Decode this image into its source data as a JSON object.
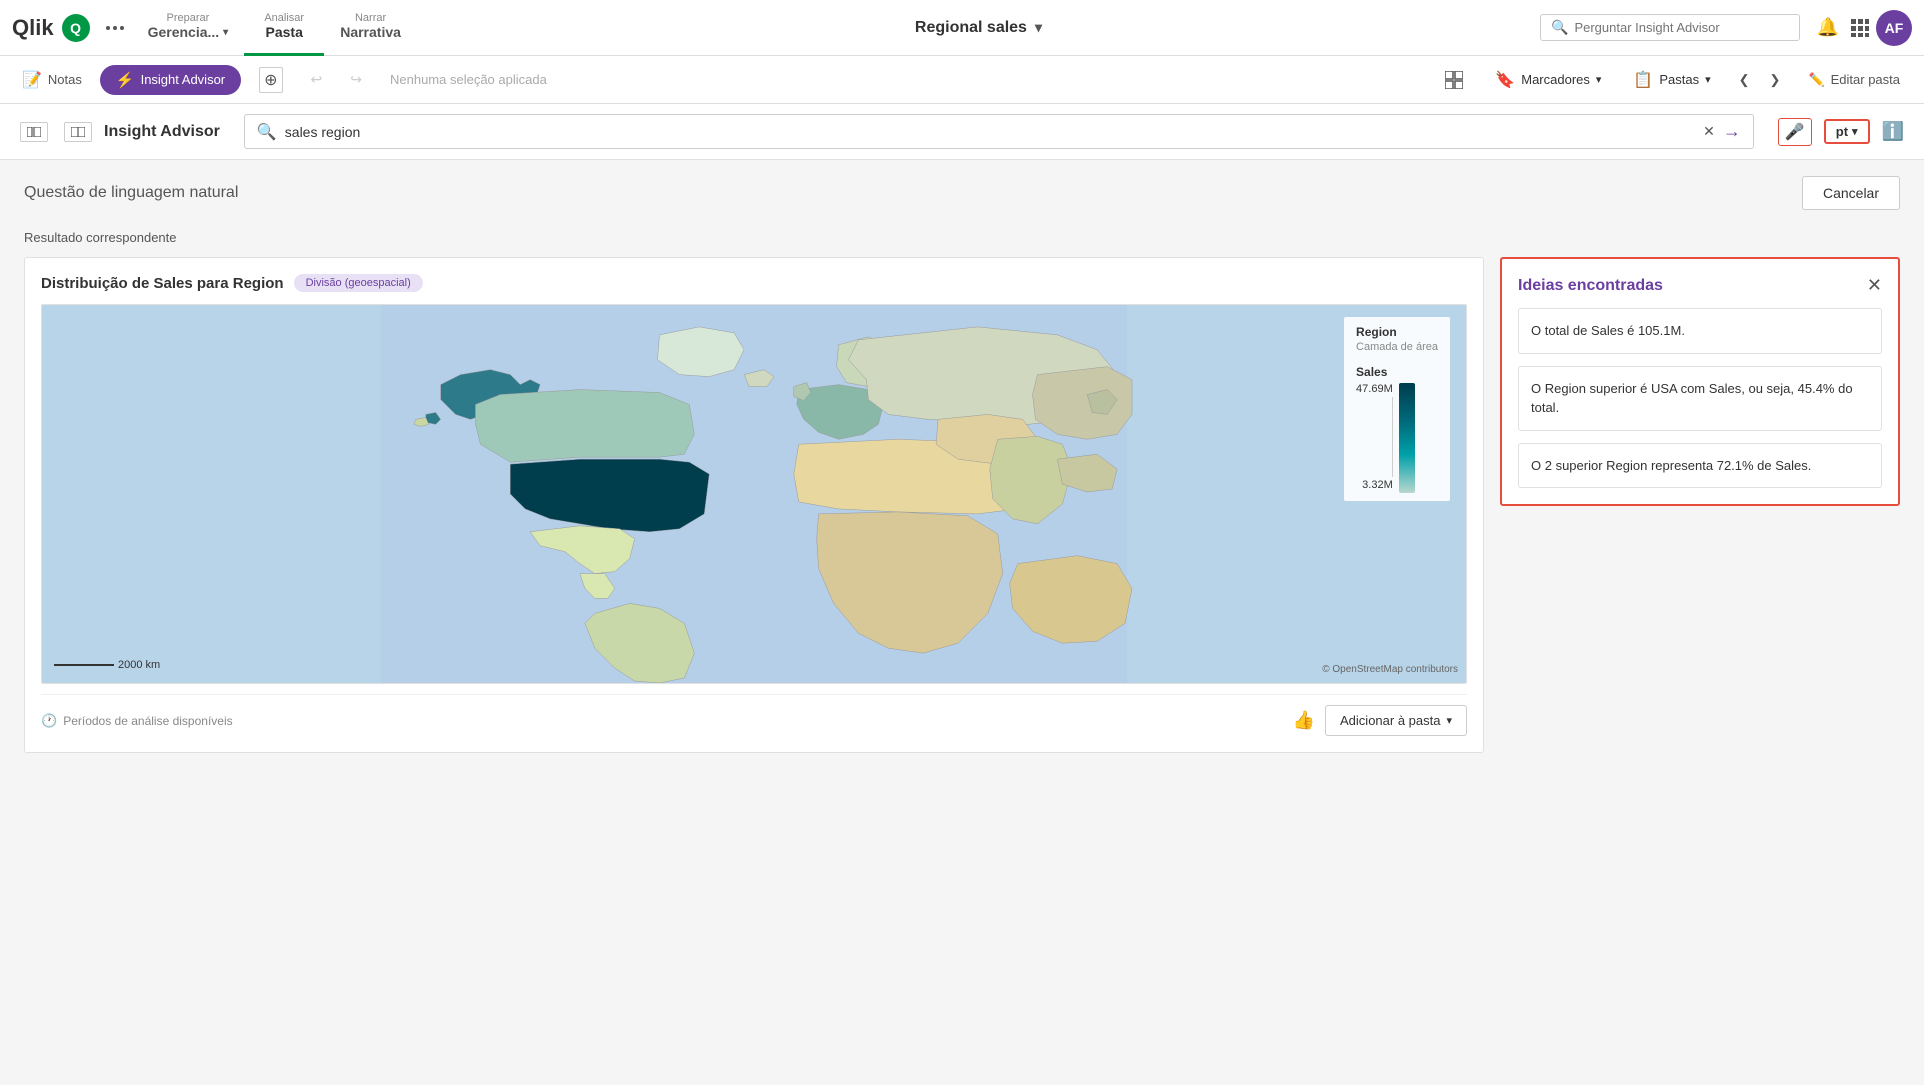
{
  "nav": {
    "logo_text": "Qlik",
    "logo_circle": "Q",
    "tabs": [
      {
        "label": "Preparar",
        "value": "Gerencia...",
        "has_dropdown": true,
        "active": false
      },
      {
        "label": "Analisar",
        "value": "Pasta",
        "has_dropdown": false,
        "active": true
      },
      {
        "label": "Narrar",
        "value": "Narrativa",
        "has_dropdown": false,
        "active": false
      }
    ],
    "app_title": "Regional sales",
    "search_placeholder": "Perguntar Insight Advisor",
    "avatar": "AF"
  },
  "toolbar": {
    "notes_label": "Notas",
    "insight_advisor_label": "Insight Advisor",
    "no_selection_label": "Nenhuma seleção aplicada",
    "bookmarks_label": "Marcadores",
    "sheets_label": "Pastas",
    "edit_label": "Editar pasta"
  },
  "ia_header": {
    "title": "Insight Advisor",
    "search_value": "sales region",
    "language": "pt"
  },
  "main": {
    "nlq_title": "Questão de linguagem natural",
    "cancel_label": "Cancelar",
    "result_label": "Resultado correspondente",
    "chart": {
      "title": "Distribuição de Sales para Region",
      "badge": "Divisão (geoespacial)",
      "legend_title": "Region",
      "legend_sub": "Camada de área",
      "legend_sales": "Sales",
      "legend_max": "47.69M",
      "legend_min": "3.32M",
      "scale_label": "2000 km",
      "credit": "© OpenStreetMap contributors",
      "periods_label": "Períodos de análise disponíveis",
      "add_label": "Adicionar à pasta"
    },
    "ideas": {
      "title": "Ideias encontradas",
      "items": [
        "O total de Sales é 105.1M.",
        "O Region superior é USA com Sales, ou seja, 45.4% do total.",
        "O 2 superior Region representa 72.1% de Sales."
      ]
    }
  }
}
